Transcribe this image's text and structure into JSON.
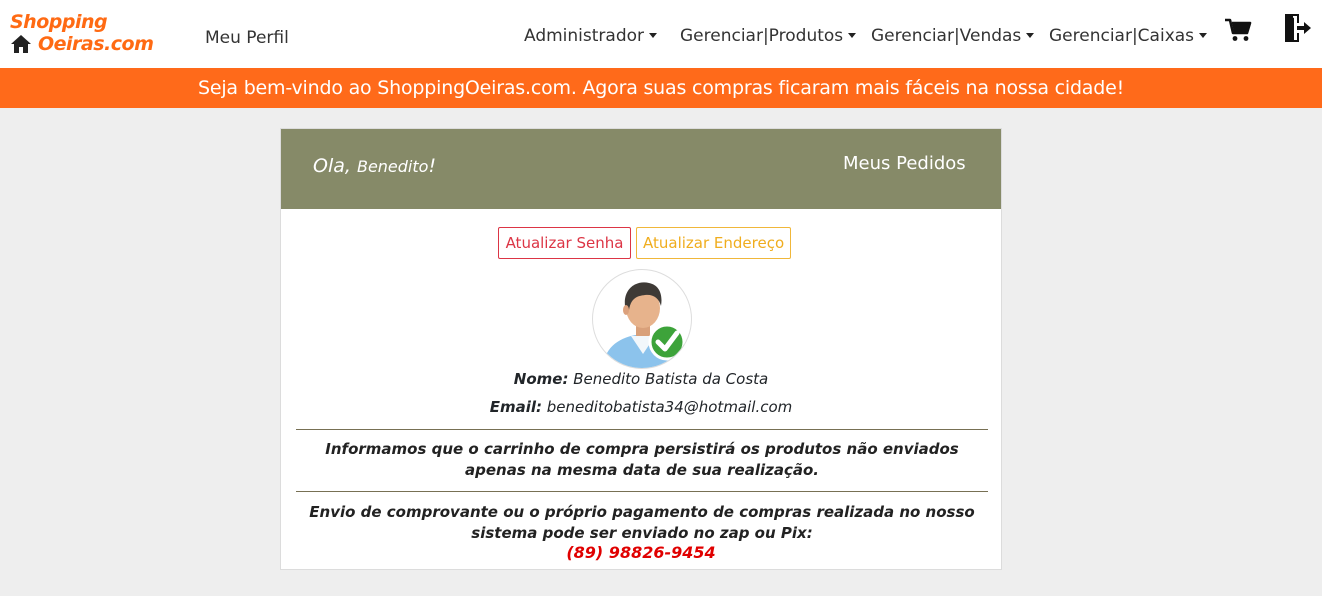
{
  "navbar": {
    "brand_line1": "Shopping",
    "brand_line2": "Oeiras.com",
    "profile_link": "Meu Perfil",
    "menus": [
      {
        "label": "Administrador"
      },
      {
        "label": "Gerenciar|Produtos"
      },
      {
        "label": "Gerenciar|Vendas"
      },
      {
        "label": "Gerenciar|Caixas"
      }
    ],
    "icons": [
      "home-icon",
      "cart-icon",
      "logout-icon",
      "caret-down-icon"
    ]
  },
  "banner": {
    "text": "Seja bem-vindo ao ShoppingOeiras.com. Agora suas compras ficaram mais fáceis na nossa cidade!"
  },
  "profile": {
    "greeting_prefix": "Ola,",
    "greeting_name": "Benedito",
    "greeting_suffix": "!",
    "orders_link": "Meus Pedidos",
    "update_password": "Atualizar Senha",
    "update_address": "Atualizar Endereço",
    "name_label": "Nome:",
    "name_value": "Benedito Batista da Costa",
    "email_label": "Email:",
    "email_value": "beneditobatista34@hotmail.com",
    "notice_cart": "Informamos que o carrinho de compra persistirá os produtos não enviados apenas na mesma data de sua realização.",
    "notice_payment": "Envio de comprovante ou o próprio pagamento de compras realizada no nosso sistema pode ser enviado no zap ou Pix:",
    "phone": "(89) 98826-9454"
  },
  "colors": {
    "brand": "#ff6a13",
    "banner_bg": "#ff6a1a",
    "card_header_bg": "#868a68",
    "danger": "#dc3545",
    "warning": "#f0ad1e",
    "phone": "#e00000",
    "page_bg": "#eeeeee"
  }
}
